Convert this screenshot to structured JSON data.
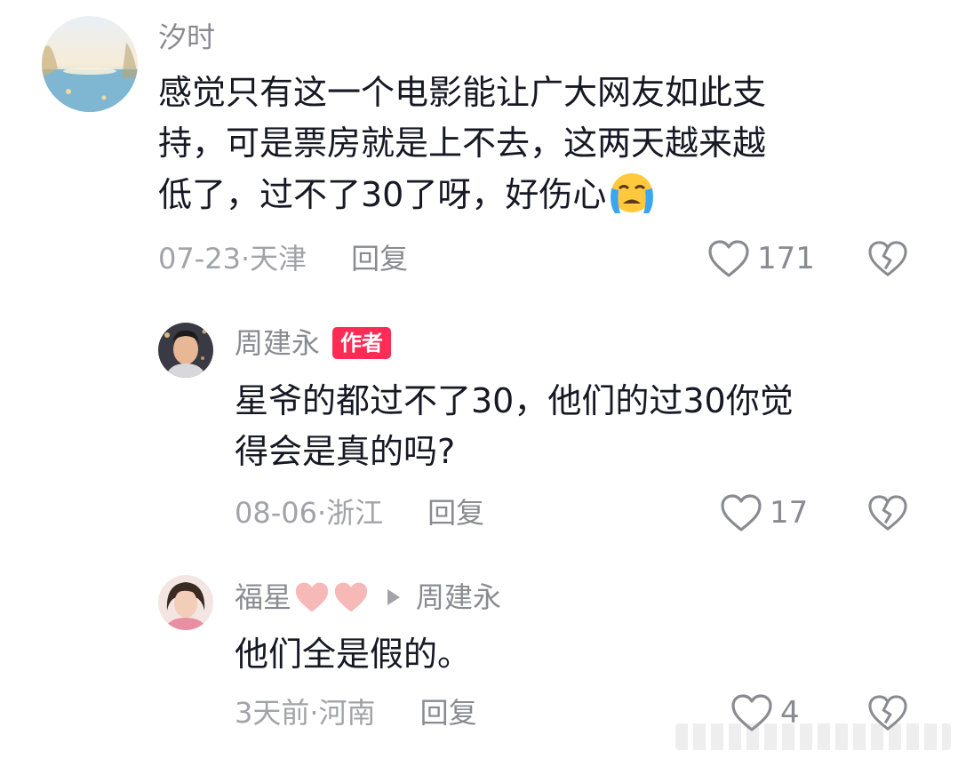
{
  "comments": [
    {
      "username": "汐时",
      "text_lines": [
        "感觉只有这一个电影能让广大网友如此支",
        "持，可是票房就是上不去，这两天越来越",
        "低了，过不了30了呀，好伤心"
      ],
      "emoji": "loudly-crying-face-emoji",
      "date": "07-23",
      "location": "天津",
      "reply_label": "回复",
      "likes": "171"
    },
    {
      "username": "周建永",
      "badge": "作者",
      "text_lines": [
        "星爷的都过不了30，他们的过30你觉",
        "得会是真的吗?"
      ],
      "date": "08-06",
      "location": "浙江",
      "reply_label": "回复",
      "likes": "17"
    },
    {
      "username": "福星",
      "reply_to": "周建永",
      "name_emoji": "pink-heart-emoji",
      "text_lines": [
        "他们全是假的。"
      ],
      "date": "3天前",
      "location": "河南",
      "reply_label": "回复",
      "likes": "4"
    }
  ],
  "separator": " · ",
  "colors": {
    "text": "#161823",
    "muted": "#a2a3a8",
    "username": "#8a8b91",
    "author_badge": "#fe2c55",
    "heart_emoji": "#f7b8b8"
  }
}
